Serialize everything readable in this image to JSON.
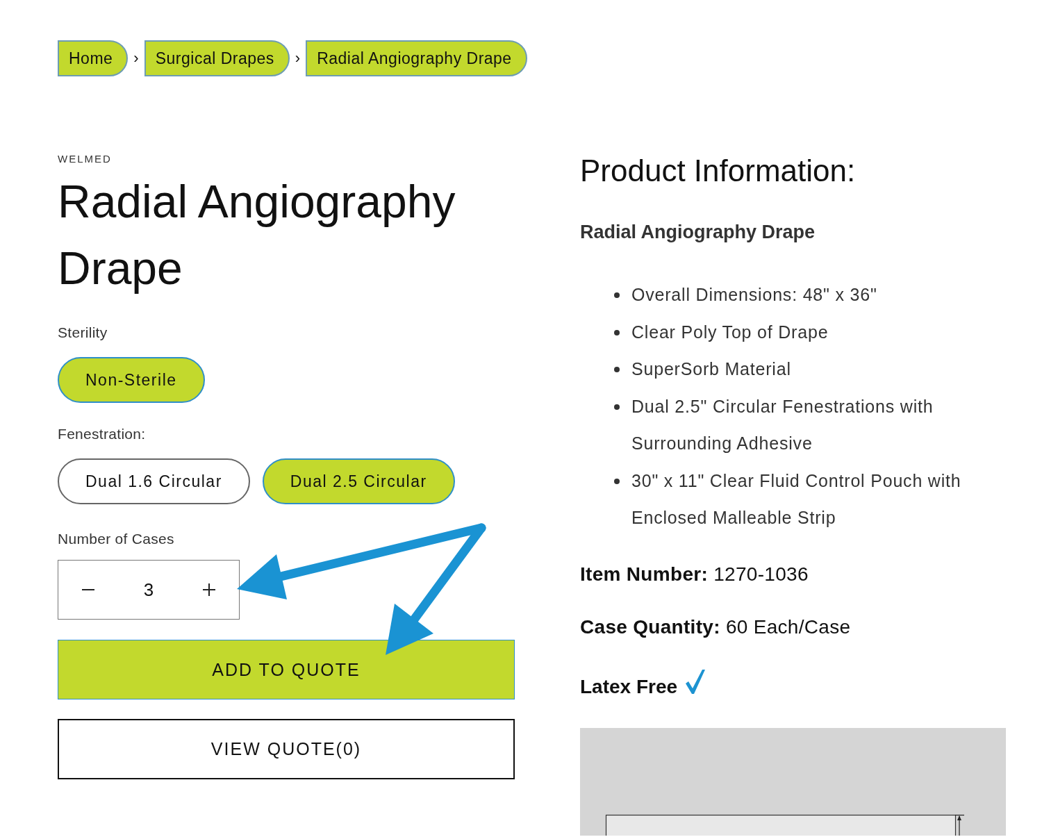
{
  "breadcrumbs": [
    {
      "label": "Home",
      "separator": "›"
    },
    {
      "label": "Surgical Drapes",
      "separator": "›"
    },
    {
      "label": "Radial Angiography Drape"
    }
  ],
  "product": {
    "vendor": "WELMED",
    "title": "Radial Angiography Drape"
  },
  "options": [
    {
      "label": "Sterility",
      "values": [
        {
          "label": "Non-Sterile",
          "selected": true
        }
      ]
    },
    {
      "label": "Fenestration:",
      "values": [
        {
          "label": "Dual 1.6 Circular",
          "selected": false
        },
        {
          "label": "Dual 2.5 Circular",
          "selected": true
        }
      ]
    }
  ],
  "quantity": {
    "label": "Number of Cases",
    "value": "3"
  },
  "buttons": [
    {
      "label": "ADD TO QUOTE",
      "kind": "primary"
    },
    {
      "label": "VIEW QUOTE(0)",
      "kind": "secondary"
    }
  ],
  "info": {
    "heading": "Product Information:",
    "subheading": "Radial Angiography Drape",
    "features": [
      "Overall Dimensions: 48\" x 36\"",
      "Clear Poly Top of Drape",
      "SuperSorb Material",
      "Dual 2.5\" Circular Fenestrations with Surrounding Adhesive",
      "30\" x 11\" Clear Fluid Control Pouch with Enclosed Malleable Strip"
    ],
    "specs": [
      "**Item Number:** 1270-1036",
      "**Case Quantity:** 60 Each/Case"
    ],
    "latex_free": {
      "label": "Latex Free",
      "checked": true
    }
  }
}
